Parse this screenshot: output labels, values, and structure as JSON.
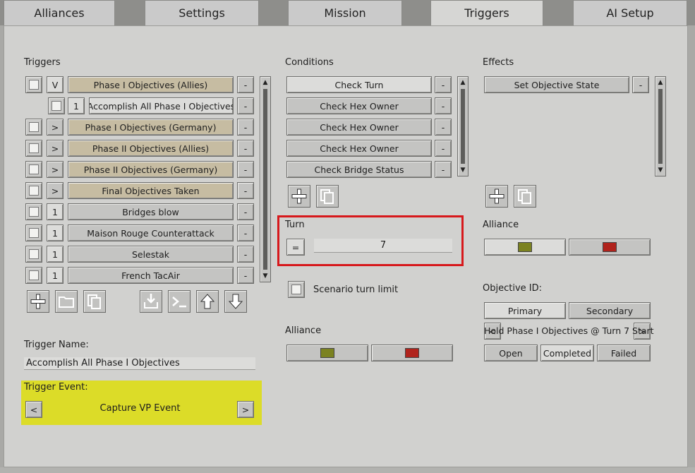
{
  "tabs": [
    "Alliances",
    "Settings",
    "Mission",
    "Triggers",
    "AI Setup"
  ],
  "triggers": {
    "header": "Triggers",
    "rows": [
      {
        "mode": "V",
        "label": "Phase I Objectives (Allies)",
        "remove": "-"
      },
      {
        "mode": "1",
        "label": "Accomplish All Phase I Objectives",
        "remove": "-"
      },
      {
        "mode": ">",
        "label": "Phase I Objectives (Germany)",
        "remove": "-"
      },
      {
        "mode": ">",
        "label": "Phase II Objectives (Allies)",
        "remove": "-"
      },
      {
        "mode": ">",
        "label": "Phase II Objectives (Germany)",
        "remove": "-"
      },
      {
        "mode": ">",
        "label": "Final Objectives Taken",
        "remove": "-"
      },
      {
        "mode": "1",
        "label": "Bridges blow",
        "remove": "-"
      },
      {
        "mode": "1",
        "label": "Maison Rouge Counterattack",
        "remove": "-"
      },
      {
        "mode": "1",
        "label": "Selestak",
        "remove": "-"
      },
      {
        "mode": "1",
        "label": "French TacAir",
        "remove": "-"
      }
    ],
    "name_label": "Trigger Name:",
    "name_value": "Accomplish All Phase I Objectives",
    "event_label": "Trigger Event:",
    "event_prev": "<",
    "event_value": "Capture VP Event",
    "event_next": ">"
  },
  "conditions": {
    "header": "Conditions",
    "rows": [
      {
        "label": "Check Turn",
        "remove": "-"
      },
      {
        "label": "Check Hex Owner",
        "remove": "-"
      },
      {
        "label": "Check Hex Owner",
        "remove": "-"
      },
      {
        "label": "Check Hex Owner",
        "remove": "-"
      },
      {
        "label": "Check Bridge Status",
        "remove": "-"
      }
    ],
    "turn_label": "Turn",
    "turn_operator": "=",
    "turn_value": "7",
    "scenario_limit_label": "Scenario turn limit",
    "alliance_label": "Alliance"
  },
  "effects": {
    "header": "Effects",
    "rows": [
      {
        "label": "Set Objective State",
        "remove": "-"
      }
    ],
    "alliance_label": "Alliance",
    "objective_id_label": "Objective ID:",
    "primary": "Primary",
    "secondary": "Secondary",
    "objective_prev": "<",
    "objective_value": "Hold Phase I Objectives @ Turn 7 Start",
    "objective_next": ">",
    "state_open": "Open",
    "state_completed": "Completed",
    "state_failed": "Failed"
  },
  "colors": {
    "allies_swatch": "#7b8220",
    "axis_swatch": "#b0231c",
    "highlight_red": "#d7191c",
    "highlight_yellow": "#dcdc28",
    "tan_button": "#c6bca2"
  },
  "icons": [
    "add-icon",
    "folder-icon",
    "copy-icon",
    "import-icon",
    "script-icon",
    "move-up-icon",
    "move-down-icon"
  ]
}
